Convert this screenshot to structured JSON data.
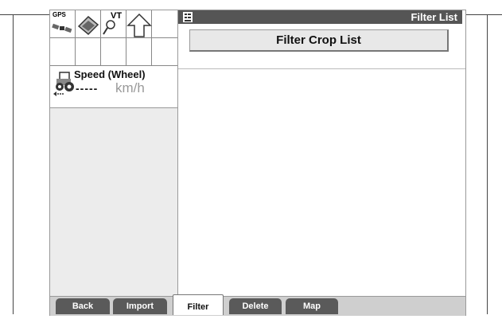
{
  "status_icons": {
    "gps": "GPS",
    "vt": "VT"
  },
  "speed": {
    "title": "Speed (Wheel)",
    "value": "-----",
    "unit": "km/h"
  },
  "title_bar": {
    "title": "Filter List"
  },
  "main": {
    "filter_button": "Filter Crop List"
  },
  "tabs": [
    {
      "label": "Back"
    },
    {
      "label": "Import"
    },
    {
      "label": "Filter",
      "active": true
    },
    {
      "label": "Delete"
    },
    {
      "label": "Map"
    }
  ],
  "colors": {
    "title_bar": "#555555",
    "tab": "#5a5a5a",
    "pane_bg": "#ececec"
  }
}
